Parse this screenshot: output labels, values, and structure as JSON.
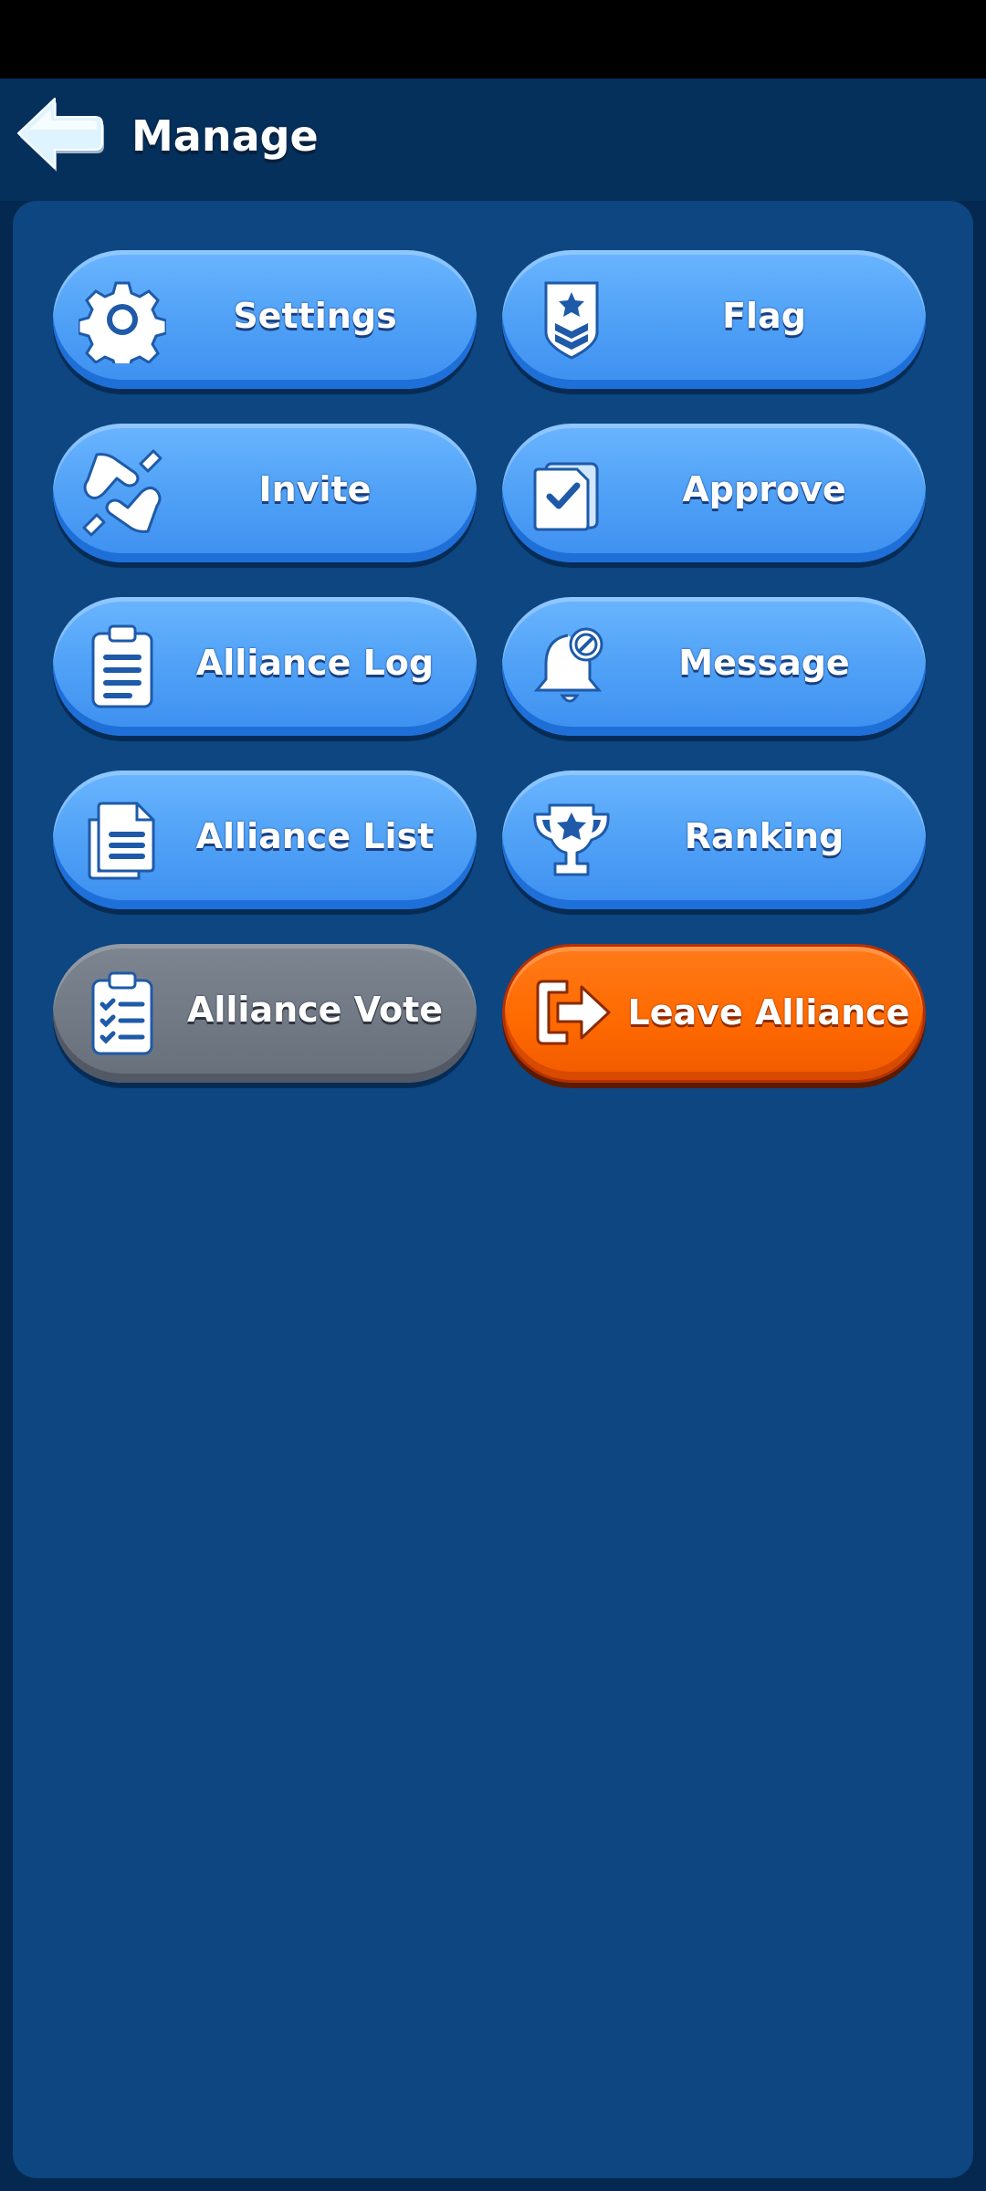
{
  "header": {
    "title": "Manage",
    "back_icon": "left-arrow-icon"
  },
  "buttons": {
    "settings": {
      "label": "Settings",
      "icon": "gear-icon"
    },
    "flag": {
      "label": "Flag",
      "icon": "flag-badge-icon"
    },
    "invite": {
      "label": "Invite",
      "icon": "handshake-icon"
    },
    "approve": {
      "label": "Approve",
      "icon": "document-check-icon"
    },
    "alliance_log": {
      "label": "Alliance Log",
      "icon": "clipboard-icon"
    },
    "message": {
      "label": "Message",
      "icon": "bell-icon"
    },
    "alliance_list": {
      "label": "Alliance List",
      "icon": "documents-icon"
    },
    "ranking": {
      "label": "Ranking",
      "icon": "trophy-icon"
    },
    "alliance_vote": {
      "label": "Alliance Vote",
      "icon": "checklist-icon"
    },
    "leave_alliance": {
      "label": "Leave Alliance",
      "icon": "exit-icon"
    }
  },
  "colors": {
    "background": "#04284f",
    "panel": "#0d4680",
    "button_blue": "#52a3f7",
    "button_gray": "#676f7b",
    "button_orange": "#ff6a00"
  }
}
